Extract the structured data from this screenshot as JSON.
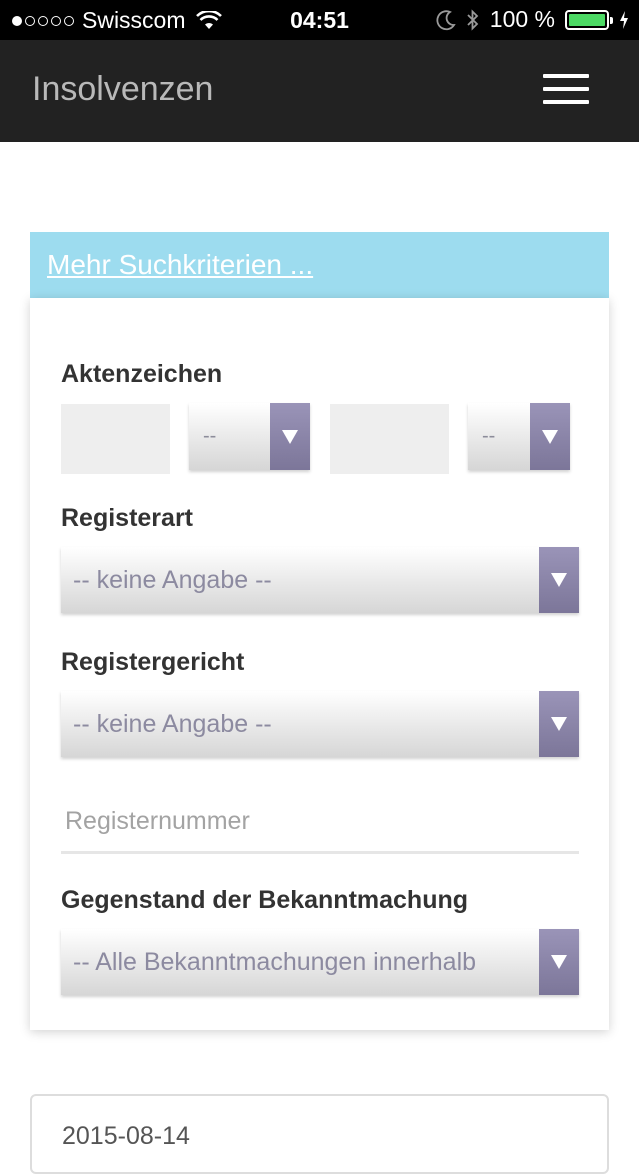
{
  "status_bar": {
    "carrier": "Swisscom",
    "time": "04:51",
    "battery_percent": "100 %",
    "signal_bars": 1,
    "battery_level": 1.0,
    "battery_color": "#4cd964"
  },
  "navbar": {
    "title": "Insolvenzen",
    "menu_icon": "hamburger-icon"
  },
  "search": {
    "more_criteria_link": "Mehr Suchkriterien ...",
    "aktenzeichen": {
      "label": "Aktenzeichen",
      "select1_value": "--",
      "select2_value": "--"
    },
    "registerart": {
      "label": "Registerart",
      "value": "-- keine Angabe --"
    },
    "registergericht": {
      "label": "Registergericht",
      "value": "-- keine Angabe --"
    },
    "registernummer": {
      "placeholder": "Registernummer"
    },
    "gegenstand": {
      "label": "Gegenstand der Bekanntmachung",
      "value": "-- Alle Bekanntmachungen innerhalb"
    },
    "date": {
      "value": "2015-08-14"
    }
  },
  "colors": {
    "header_bg": "#9ddcef",
    "navbar_bg": "#222222",
    "select_arrow": "#8a84a8"
  }
}
